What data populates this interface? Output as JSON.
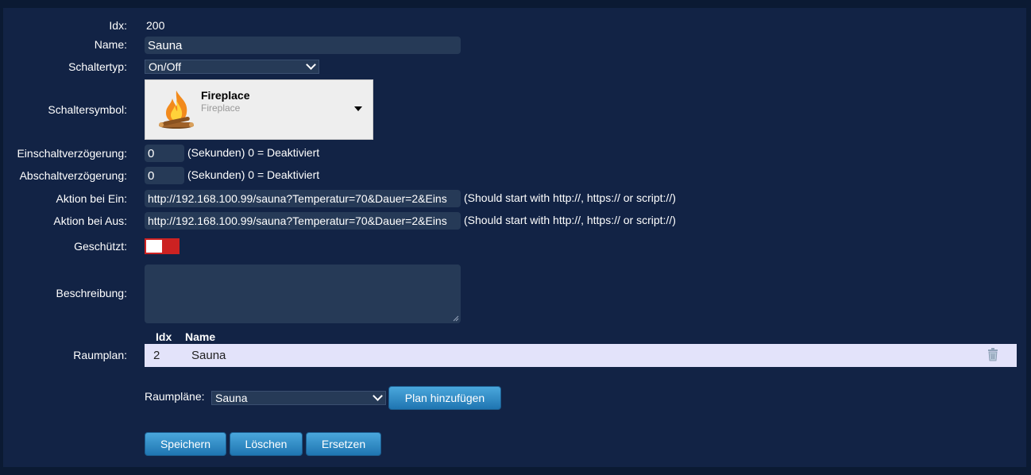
{
  "labels": {
    "idx": "Idx:",
    "name": "Name:",
    "switch_type": "Schaltertyp:",
    "switch_icon": "Schaltersymbol:",
    "on_delay": "Einschaltverzögerung:",
    "off_delay": "Abschaltverzögerung:",
    "on_action": "Aktion bei Ein:",
    "off_action": "Aktion bei Aus:",
    "protected": "Geschützt:",
    "description": "Beschreibung:",
    "roomplan": "Raumplan:"
  },
  "device": {
    "idx": "200",
    "name": "Sauna",
    "switch_type": "On/Off",
    "icon": {
      "name": "fireplace-icon",
      "title": "Fireplace",
      "subtitle": "Fireplace"
    },
    "on_delay": "0",
    "off_delay": "0",
    "delay_hint": "(Sekunden) 0 = Deaktiviert",
    "on_action": "http://192.168.100.99/sauna?Temperatur=70&Dauer=2&Eins",
    "off_action": "http://192.168.100.99/sauna?Temperatur=70&Dauer=2&Eins",
    "action_hint": "(Should start with http://, https:// or script://)",
    "protected": false,
    "description": ""
  },
  "roomplan_table": {
    "headers": {
      "idx": "Idx",
      "name": "Name"
    },
    "rows": [
      {
        "idx": "2",
        "name": "Sauna"
      }
    ]
  },
  "roomplans": {
    "label": "Raumpläne:",
    "selected": "Sauna",
    "add_button": "Plan hinzufügen"
  },
  "buttons": {
    "save": "Speichern",
    "delete": "Löschen",
    "replace": "Ersetzen"
  },
  "colors": {
    "background": "#0b1a33",
    "panel": "#122345",
    "field": "#263a57",
    "toggle_off": "#cc2222",
    "button": "#2a8ac8",
    "table_row": "#e3e3fa"
  }
}
